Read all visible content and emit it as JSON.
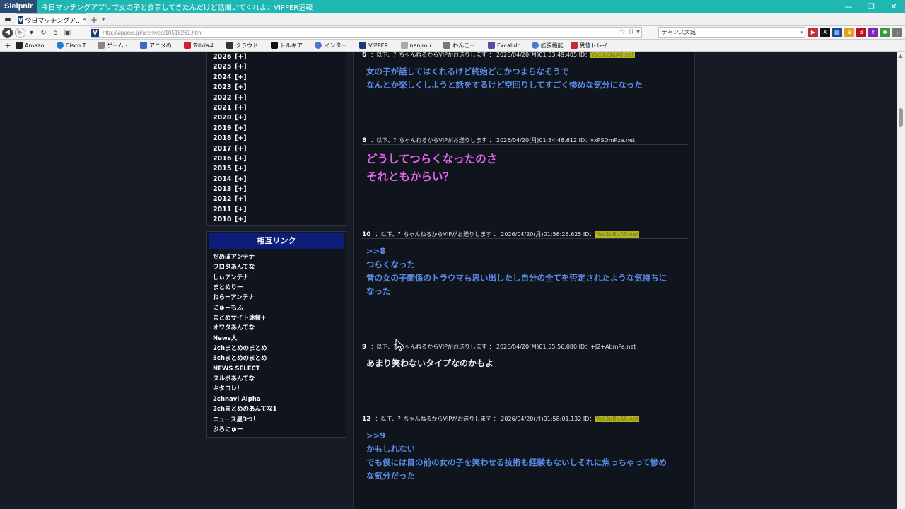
{
  "window": {
    "app_name": "Sleipnir",
    "title": "今日マッチングアプリで女の子と食事してきたんだけど話聞いてくれよ：VIPPER速報",
    "controls": [
      "—",
      "❐",
      "✕"
    ]
  },
  "tabs": [
    {
      "label": "今日マッチングア...",
      "close": "✕"
    }
  ],
  "tab_new": "+",
  "tab_list": "▾",
  "address": {
    "url": "http://vippers.jp/archives/10518261.html",
    "search_value": "チャンス大城"
  },
  "bookmarks": [
    {
      "label": "Amazo...",
      "color": "#222222"
    },
    {
      "label": "Cisco T...",
      "color": "#1a7fd0"
    },
    {
      "label": "ゲーム -...",
      "color": "#888888"
    },
    {
      "label": "アニメの...",
      "color": "#3a6ac8"
    },
    {
      "label": "Tolkia#...",
      "color": "#d02030"
    },
    {
      "label": "クラウド...",
      "color": "#333333"
    },
    {
      "label": "トルキア...",
      "color": "#111111"
    },
    {
      "label": "インター...",
      "color": "#4a7ad0"
    },
    {
      "label": "VIPPER...",
      "color": "#1a3a7a"
    },
    {
      "label": "nanjmu...",
      "color": "#aaaaaa"
    },
    {
      "label": "わんこー...",
      "color": "#777777"
    },
    {
      "label": "Excalidr...",
      "color": "#5a4ab0"
    },
    {
      "label": "拡張機能",
      "color": "#4a7ad0"
    },
    {
      "label": "受信トレイ",
      "color": "#c03030"
    }
  ],
  "sidebar": {
    "archive_years": [
      {
        "year": "2026",
        "toggle": "[+]"
      },
      {
        "year": "2025",
        "toggle": "[+]"
      },
      {
        "year": "2024",
        "toggle": "[+]"
      },
      {
        "year": "2023",
        "toggle": "[+]"
      },
      {
        "year": "2022",
        "toggle": "[+]"
      },
      {
        "year": "2021",
        "toggle": "[+]"
      },
      {
        "year": "2020",
        "toggle": "[+]"
      },
      {
        "year": "2019",
        "toggle": "[+]"
      },
      {
        "year": "2018",
        "toggle": "[+]"
      },
      {
        "year": "2017",
        "toggle": "[+]"
      },
      {
        "year": "2016",
        "toggle": "[+]"
      },
      {
        "year": "2015",
        "toggle": "[+]"
      },
      {
        "year": "2014",
        "toggle": "[+]"
      },
      {
        "year": "2013",
        "toggle": "[+]"
      },
      {
        "year": "2012",
        "toggle": "[+]"
      },
      {
        "year": "2011",
        "toggle": "[+]"
      },
      {
        "year": "2010",
        "toggle": "[+]"
      }
    ],
    "links_title": "相互リンク",
    "links": [
      "だめぽアンテナ",
      "ワロタあんてな",
      "しぃアンテナ",
      "まとめりー",
      "ねらーアンテナ",
      "にゅーもふ",
      "まとめサイト速報+",
      "オワタあんてな",
      "News人",
      "2chまとめのまとめ",
      "5chまとめのまとめ",
      "NEWS SELECT",
      "ヌルポあんてな",
      "キタコレ！",
      "2chnavi Alpha",
      "2chまとめのあんてな1",
      "ニュース星3つ！",
      "ぶろにゅー"
    ]
  },
  "posts": [
    {
      "num": "6",
      "head": "：以下、？ちゃんねるからVIPがお送りします ： 2026/04/20(月)01:53:49.405 ID：",
      "id": "Yed3oBqA0.net",
      "highlight": true,
      "style": "blue",
      "lines": [
        "女の子が話してはくれるけど終始どこかつまらなそうで",
        "なんとか楽しくしようと話をするけど空回りしてすごく惨めな気分になった"
      ]
    },
    {
      "num": "8",
      "head": "：以下、？ちゃんねるからVIPがお送りします ： 2026/04/20(月)01:54:48.612 ID：",
      "id": "vxPSDmPza.net",
      "highlight": false,
      "style": "pink",
      "lines": [
        "どうしてつらくなったのさ",
        "それともからい？"
      ]
    },
    {
      "num": "10",
      "head": "：以下、？ちゃんねるからVIPがお送りします ： 2026/04/20(月)01:56:26.625 ID：",
      "id": "Yed3oBqA0.net",
      "highlight": true,
      "style": "blue",
      "lines": [
        ">>8",
        "つらくなった",
        "昔の女の子関係のトラウマも思い出したし自分の全てを否定されたような気持ちに",
        "なった"
      ]
    },
    {
      "num": "9",
      "head": "：以下、？ちゃんねるからVIPがお送りします ： 2026/04/20(月)01:55:56.080 ID：",
      "id": "+J2+AbmPa.net",
      "highlight": false,
      "style": "white",
      "lines": [
        "あまり笑わないタイプなのかもよ"
      ]
    },
    {
      "num": "12",
      "head": "：以下、？ちゃんねるからVIPがお送りします ： 2026/04/20(月)01:58:01.132 ID：",
      "id": "Yed3oBqA0.net",
      "highlight": true,
      "style": "blue",
      "lines": [
        ">>9",
        "かもしれない",
        "でも僕には目の前の女の子を笑わせる技術も経験もないしそれに焦っちゃって惨め",
        "な気分だった"
      ]
    }
  ]
}
